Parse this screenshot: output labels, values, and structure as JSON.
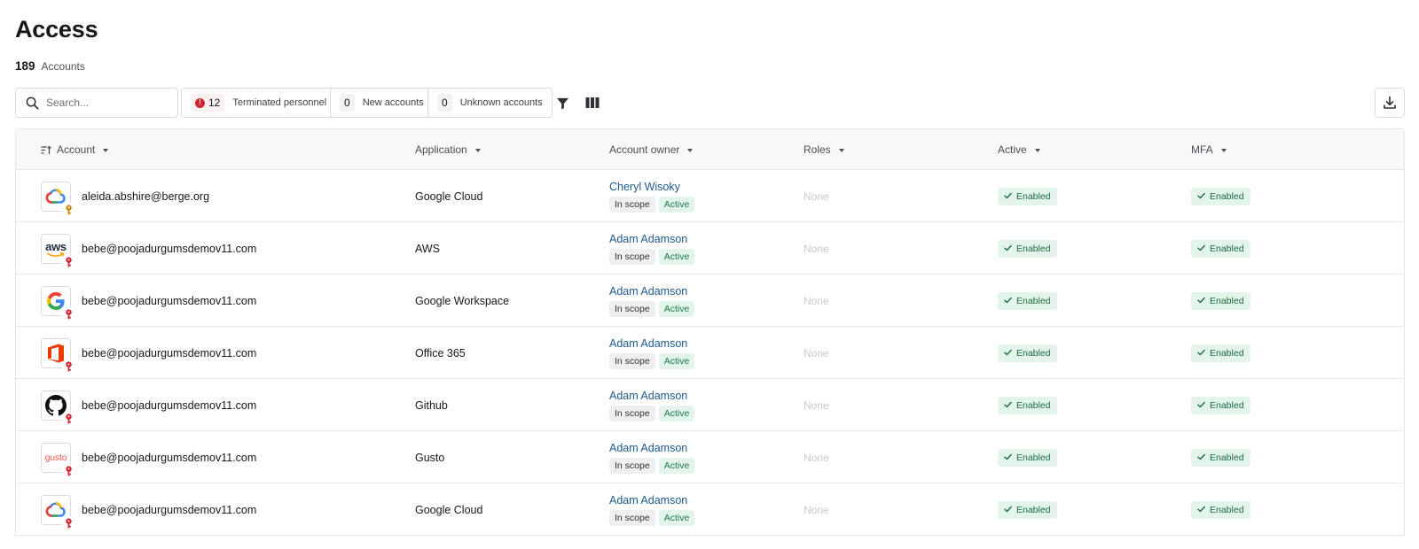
{
  "page": {
    "title": "Access",
    "count": "189",
    "count_label": "Accounts"
  },
  "toolbar": {
    "search_placeholder": "Search...",
    "filters": [
      {
        "count": "12",
        "label": "Terminated personnel",
        "alert": true
      },
      {
        "count": "0",
        "label": "New accounts",
        "alert": false
      },
      {
        "count": "0",
        "label": "Unknown accounts",
        "alert": false
      }
    ],
    "alert_symbol": "!"
  },
  "table": {
    "columns": [
      "Account",
      "Application",
      "Account owner",
      "Roles",
      "Active",
      "MFA"
    ],
    "rows": [
      {
        "logo": "google-cloud",
        "account": "aleida.abshire@berge.org",
        "application": "Google Cloud",
        "owner": "Cheryl Wisoky",
        "scope": "In scope",
        "status": "Active",
        "roles": "None",
        "active": "Enabled",
        "mfa": "Enabled",
        "badge_color": "#c98a14"
      },
      {
        "logo": "aws",
        "account": "bebe@poojadurgumsdemov11.com",
        "application": "AWS",
        "owner": "Adam Adamson",
        "scope": "In scope",
        "status": "Active",
        "roles": "None",
        "active": "Enabled",
        "mfa": "Enabled",
        "badge_color": "#d1242f"
      },
      {
        "logo": "google",
        "account": "bebe@poojadurgumsdemov11.com",
        "application": "Google Workspace",
        "owner": "Adam Adamson",
        "scope": "In scope",
        "status": "Active",
        "roles": "None",
        "active": "Enabled",
        "mfa": "Enabled",
        "badge_color": "#d1242f"
      },
      {
        "logo": "office",
        "account": "bebe@poojadurgumsdemov11.com",
        "application": "Office 365",
        "owner": "Adam Adamson",
        "scope": "In scope",
        "status": "Active",
        "roles": "None",
        "active": "Enabled",
        "mfa": "Enabled",
        "badge_color": "#d1242f"
      },
      {
        "logo": "github",
        "account": "bebe@poojadurgumsdemov11.com",
        "application": "Github",
        "owner": "Adam Adamson",
        "scope": "In scope",
        "status": "Active",
        "roles": "None",
        "active": "Enabled",
        "mfa": "Enabled",
        "badge_color": "#d1242f"
      },
      {
        "logo": "gusto",
        "account": "bebe@poojadurgumsdemov11.com",
        "application": "Gusto",
        "owner": "Adam Adamson",
        "scope": "In scope",
        "status": "Active",
        "roles": "None",
        "active": "Enabled",
        "mfa": "Enabled",
        "badge_color": "#d1242f"
      },
      {
        "logo": "google-cloud",
        "account": "bebe@poojadurgumsdemov11.com",
        "application": "Google Cloud",
        "owner": "Adam Adamson",
        "scope": "In scope",
        "status": "Active",
        "roles": "None",
        "active": "Enabled",
        "mfa": "Enabled",
        "badge_color": "#d1242f"
      }
    ]
  },
  "logo_text": {
    "aws": "aws",
    "gusto": "gusto"
  },
  "colors": {
    "link": "#1f5a8c",
    "enabled_bg": "#e3f4ea",
    "enabled_text": "#1b6b3f",
    "alert": "#d1242f"
  }
}
